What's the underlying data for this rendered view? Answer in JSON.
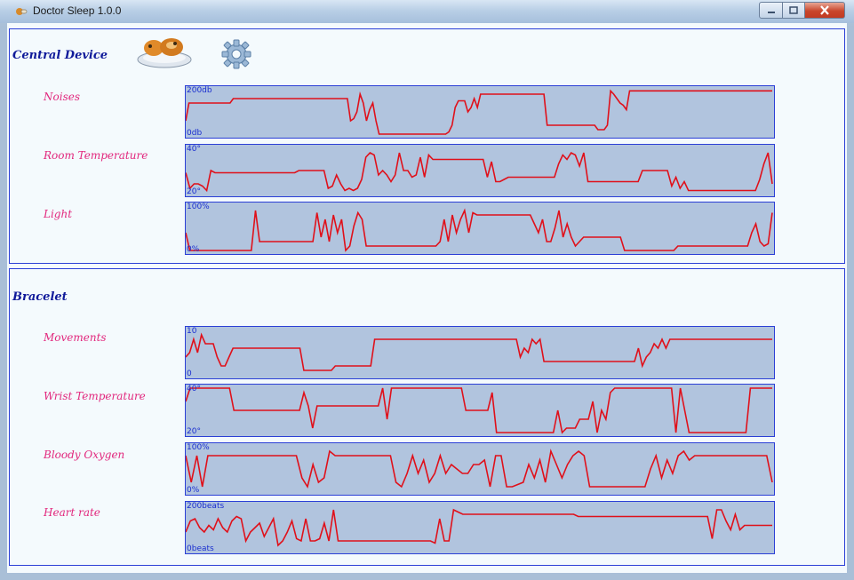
{
  "window": {
    "title": "Doctor Sleep 1.0.0"
  },
  "central": {
    "title": "Central Device",
    "rows": [
      {
        "label": "Noises",
        "ymax": "200db",
        "ymin": "0db"
      },
      {
        "label": "Room Temperature",
        "ymax": "40°",
        "ymin": "20°"
      },
      {
        "label": "Light",
        "ymax": "100%",
        "ymin": "0%"
      }
    ]
  },
  "bracelet": {
    "title": "Bracelet",
    "rows": [
      {
        "label": "Movements",
        "ymax": "10",
        "ymin": "0"
      },
      {
        "label": "Wrist Temperature",
        "ymax": "40°",
        "ymin": "20°"
      },
      {
        "label": "Bloody Oxygen",
        "ymax": "100%",
        "ymin": "0%"
      },
      {
        "label": "Heart rate",
        "ymax": "200beats",
        "ymin": "0beats"
      }
    ]
  },
  "icons": [
    "pillow-icon",
    "gear-icon",
    "app-icon",
    "minimize-icon",
    "maximize-icon",
    "close-icon"
  ],
  "colors": {
    "graph_bg": "#b1c4de",
    "line": "#e0101a",
    "border": "#2b3fd6",
    "label": "#e2277d",
    "title": "#101a9a"
  },
  "chart_data": [
    {
      "type": "line",
      "name": "Noises",
      "ylim": [
        0,
        200
      ],
      "y": [
        60,
        140,
        140,
        140,
        140,
        140,
        140,
        140,
        140,
        140,
        140,
        140,
        140,
        140,
        140,
        160,
        160,
        160,
        160,
        160,
        160,
        160,
        160,
        160,
        160,
        160,
        160,
        160,
        160,
        160,
        160,
        160,
        160,
        160,
        160,
        160,
        160,
        160,
        160,
        160,
        160,
        160,
        160,
        160,
        160,
        160,
        160,
        160,
        160,
        160,
        160,
        160,
        60,
        70,
        100,
        180,
        140,
        60,
        110,
        140,
        60,
        0,
        0,
        0,
        0,
        0,
        0,
        0,
        0,
        0,
        0,
        0,
        0,
        0,
        0,
        0,
        0,
        0,
        0,
        0,
        0,
        0,
        0,
        10,
        40,
        120,
        150,
        150,
        150,
        100,
        120,
        160,
        120,
        180,
        180,
        180,
        180,
        180,
        180,
        180,
        180,
        180,
        180,
        180,
        180,
        180,
        180,
        180,
        180,
        180,
        180,
        180,
        180,
        180,
        40,
        40,
        40,
        40,
        40,
        40,
        40,
        40,
        40,
        40,
        40,
        40,
        40,
        40,
        40,
        40,
        20,
        20,
        20,
        40,
        195,
        180,
        160,
        140,
        130,
        110,
        195,
        195,
        195,
        195,
        195,
        195,
        195,
        195,
        195,
        195,
        195,
        195,
        195,
        195,
        195,
        195,
        195,
        195,
        195,
        195,
        195,
        195,
        195,
        195,
        195,
        195,
        195,
        195,
        195,
        195,
        195,
        195,
        195,
        195,
        195,
        195,
        195,
        195,
        195,
        195,
        195,
        195,
        195,
        195,
        195,
        195
      ]
    },
    {
      "type": "line",
      "name": "Room Temperature",
      "ylim": [
        20,
        40
      ],
      "y": [
        29,
        22,
        24,
        24,
        23,
        21,
        30,
        29,
        29,
        29,
        29,
        29,
        29,
        29,
        29,
        29,
        29,
        29,
        29,
        29,
        29,
        29,
        29,
        29,
        29,
        29,
        29,
        30,
        30,
        30,
        30,
        30,
        30,
        30,
        22,
        23,
        28,
        24,
        21,
        22,
        21,
        22,
        26,
        36,
        38,
        37,
        28,
        30,
        28,
        25,
        28,
        38,
        30,
        30,
        27,
        28,
        36,
        27,
        37,
        35,
        35,
        35,
        35,
        35,
        35,
        35,
        35,
        35,
        35,
        35,
        35,
        35,
        27,
        34,
        25,
        25,
        26,
        27,
        27,
        27,
        27,
        27,
        27,
        27,
        27,
        27,
        27,
        27,
        27,
        33,
        37,
        35,
        38,
        37,
        32,
        38,
        25,
        25,
        25,
        25,
        25,
        25,
        25,
        25,
        25,
        25,
        25,
        25,
        25,
        30,
        30,
        30,
        30,
        30,
        30,
        30,
        23,
        27,
        22,
        25,
        21,
        21,
        21,
        21,
        21,
        21,
        21,
        21,
        21,
        21,
        21,
        21,
        21,
        21,
        21,
        21,
        21,
        26,
        33,
        38,
        24
      ]
    },
    {
      "type": "line",
      "name": "Light",
      "ylim": [
        0,
        100
      ],
      "y": [
        40,
        0,
        0,
        0,
        0,
        0,
        0,
        0,
        0,
        0,
        0,
        0,
        0,
        0,
        0,
        0,
        0,
        90,
        20,
        20,
        20,
        20,
        20,
        20,
        20,
        20,
        20,
        20,
        20,
        20,
        20,
        20,
        85,
        30,
        70,
        20,
        80,
        40,
        70,
        0,
        10,
        55,
        85,
        70,
        10,
        10,
        10,
        10,
        10,
        10,
        10,
        10,
        10,
        10,
        10,
        10,
        10,
        10,
        10,
        10,
        10,
        10,
        20,
        70,
        20,
        80,
        40,
        70,
        90,
        40,
        85,
        80,
        80,
        80,
        80,
        80,
        80,
        80,
        80,
        80,
        80,
        80,
        80,
        80,
        80,
        60,
        40,
        70,
        20,
        20,
        50,
        90,
        30,
        60,
        30,
        10,
        20,
        30,
        30,
        30,
        30,
        30,
        30,
        30,
        30,
        30,
        30,
        0,
        0,
        0,
        0,
        0,
        0,
        0,
        0,
        0,
        0,
        0,
        0,
        0,
        10,
        10,
        10,
        10,
        10,
        10,
        10,
        10,
        10,
        10,
        10,
        10,
        10,
        10,
        10,
        10,
        10,
        10,
        40,
        60,
        20,
        10,
        15,
        85
      ]
    }
  ]
}
